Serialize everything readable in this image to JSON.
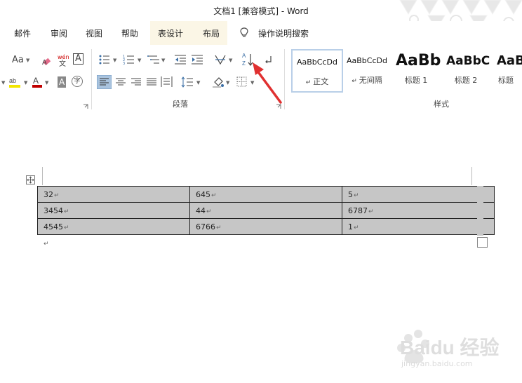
{
  "window": {
    "title": "文档1 [兼容模式]  -  Word"
  },
  "tabs": [
    {
      "label": "邮件"
    },
    {
      "label": "审阅"
    },
    {
      "label": "视图"
    },
    {
      "label": "帮助"
    },
    {
      "label": "表设计"
    },
    {
      "label": "布局"
    },
    {
      "label": "操作说明搜索"
    }
  ],
  "ribbon": {
    "font_group": {
      "change_case_label": "Aa",
      "phonetic_top": "wén",
      "phonetic_bottom": "文",
      "char_border_label": "A",
      "shading_label": "A",
      "enclose_label": "字"
    },
    "paragraph_group": {
      "label": "段落"
    },
    "styles_group": {
      "label": "样式",
      "styles": [
        {
          "sample": "AaBbCcDd",
          "name": "正文"
        },
        {
          "sample": "AaBbCcDd",
          "name": "无间隔"
        },
        {
          "sample": "AaBb",
          "name": "标题 1"
        },
        {
          "sample": "AaBbC",
          "name": "标题 2"
        },
        {
          "sample": "AaB",
          "name": "标题"
        }
      ]
    }
  },
  "table": {
    "rows": [
      [
        "32",
        "645",
        "5"
      ],
      [
        "3454",
        "44",
        "6787"
      ],
      [
        "4545",
        "6766",
        "1"
      ]
    ]
  },
  "paragraph_mark": "↵",
  "watermark": {
    "brand": "Baidu 经验",
    "url": "jingyan.baidu.com"
  },
  "colors": {
    "accent_red": "#e03030",
    "selection_gray": "#c6c6c6",
    "highlight_yellow": "#f2e600",
    "font_red": "#c00000"
  }
}
